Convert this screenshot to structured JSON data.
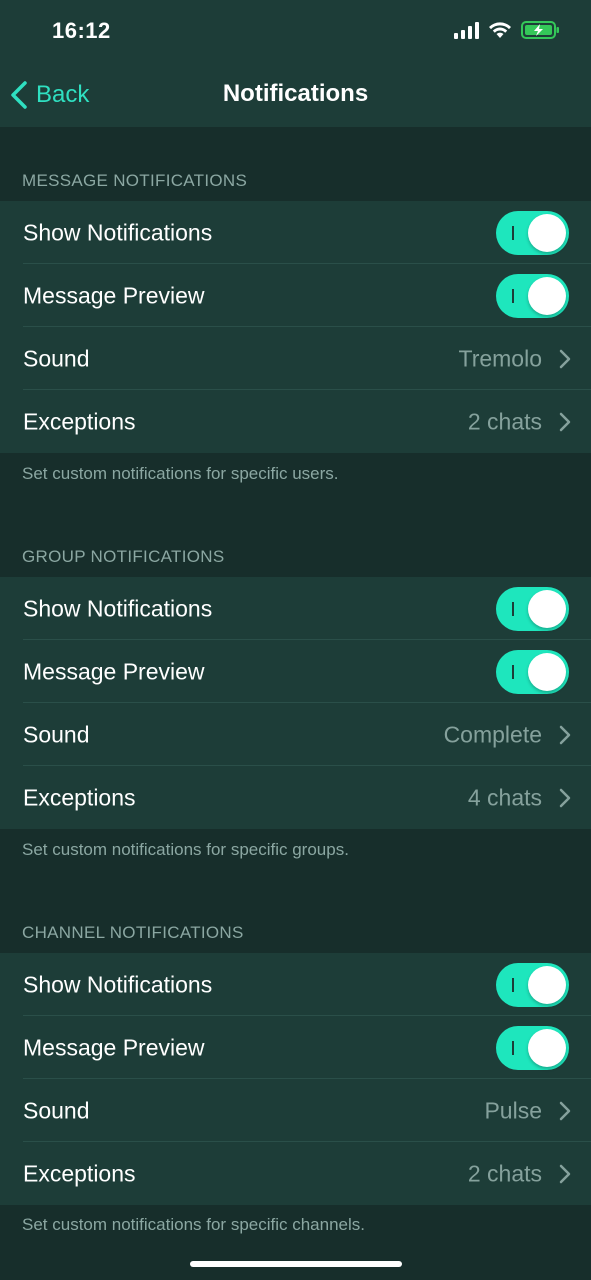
{
  "status_bar": {
    "time": "16:12",
    "icons": [
      "cellular-signal-icon",
      "wifi-icon",
      "battery-charging-icon"
    ]
  },
  "nav": {
    "back_label": "Back",
    "title": "Notifications"
  },
  "colors": {
    "accent": "#1ee6bd",
    "background": "#172e2b",
    "cell": "#1d3d38",
    "secondary_text": "#8ba7a2"
  },
  "sections": [
    {
      "header": "MESSAGE NOTIFICATIONS",
      "rows": [
        {
          "label": "Show Notifications",
          "type": "toggle",
          "on": true
        },
        {
          "label": "Message Preview",
          "type": "toggle",
          "on": true
        },
        {
          "label": "Sound",
          "type": "disclosure",
          "value": "Tremolo"
        },
        {
          "label": "Exceptions",
          "type": "disclosure",
          "value": "2 chats"
        }
      ],
      "footer": "Set custom notifications for specific users."
    },
    {
      "header": "GROUP NOTIFICATIONS",
      "rows": [
        {
          "label": "Show Notifications",
          "type": "toggle",
          "on": true
        },
        {
          "label": "Message Preview",
          "type": "toggle",
          "on": true
        },
        {
          "label": "Sound",
          "type": "disclosure",
          "value": "Complete"
        },
        {
          "label": "Exceptions",
          "type": "disclosure",
          "value": "4 chats"
        }
      ],
      "footer": "Set custom notifications for specific groups."
    },
    {
      "header": "CHANNEL NOTIFICATIONS",
      "rows": [
        {
          "label": "Show Notifications",
          "type": "toggle",
          "on": true
        },
        {
          "label": "Message Preview",
          "type": "toggle",
          "on": true
        },
        {
          "label": "Sound",
          "type": "disclosure",
          "value": "Pulse"
        },
        {
          "label": "Exceptions",
          "type": "disclosure",
          "value": "2 chats"
        }
      ],
      "footer": "Set custom notifications for specific channels."
    }
  ]
}
